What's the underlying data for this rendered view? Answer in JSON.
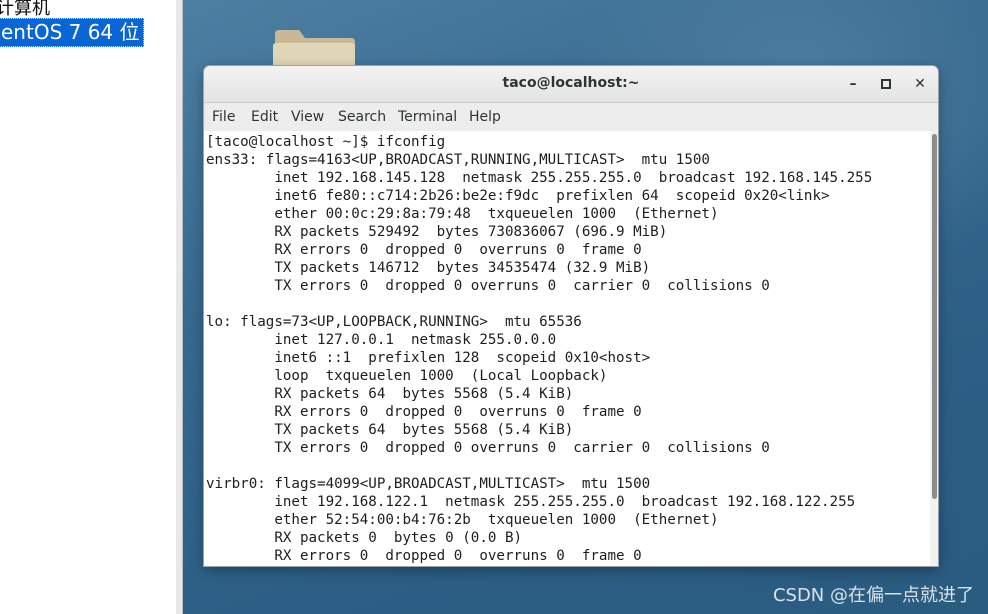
{
  "library": {
    "items": [
      "计算机",
      "entOS 7 64 位"
    ]
  },
  "terminal": {
    "title": "taco@localhost:~",
    "window_buttons": {
      "minimize": "–",
      "maximize": "▫",
      "close": "✕"
    },
    "menu": [
      "File",
      "Edit",
      "View",
      "Search",
      "Terminal",
      "Help"
    ],
    "lines": [
      "[taco@localhost ~]$ ifconfig",
      "ens33: flags=4163<UP,BROADCAST,RUNNING,MULTICAST>  mtu 1500",
      "        inet 192.168.145.128  netmask 255.255.255.0  broadcast 192.168.145.255",
      "        inet6 fe80::c714:2b26:be2e:f9dc  prefixlen 64  scopeid 0x20<link>",
      "        ether 00:0c:29:8a:79:48  txqueuelen 1000  (Ethernet)",
      "        RX packets 529492  bytes 730836067 (696.9 MiB)",
      "        RX errors 0  dropped 0  overruns 0  frame 0",
      "        TX packets 146712  bytes 34535474 (32.9 MiB)",
      "        TX errors 0  dropped 0 overruns 0  carrier 0  collisions 0",
      "",
      "lo: flags=73<UP,LOOPBACK,RUNNING>  mtu 65536",
      "        inet 127.0.0.1  netmask 255.0.0.0",
      "        inet6 ::1  prefixlen 128  scopeid 0x10<host>",
      "        loop  txqueuelen 1000  (Local Loopback)",
      "        RX packets 64  bytes 5568 (5.4 KiB)",
      "        RX errors 0  dropped 0  overruns 0  frame 0",
      "        TX packets 64  bytes 5568 (5.4 KiB)",
      "        TX errors 0  dropped 0 overruns 0  carrier 0  collisions 0",
      "",
      "virbr0: flags=4099<UP,BROADCAST,MULTICAST>  mtu 1500",
      "        inet 192.168.122.1  netmask 255.255.255.0  broadcast 192.168.122.255",
      "        ether 52:54:00:b4:76:2b  txqueuelen 1000  (Ethernet)",
      "        RX packets 0  bytes 0 (0.0 B)",
      "        RX errors 0  dropped 0  overruns 0  frame 0"
    ]
  },
  "watermark": "CSDN @在偏一点就进了",
  "colors": {
    "selection": "#0a66d6",
    "desktop": "#376a8f",
    "terminal_bg": "#ffffff",
    "terminal_fg": "#1e1e1e"
  },
  "icons": [
    "folder-icon",
    "minimize-icon",
    "maximize-icon",
    "close-icon"
  ]
}
